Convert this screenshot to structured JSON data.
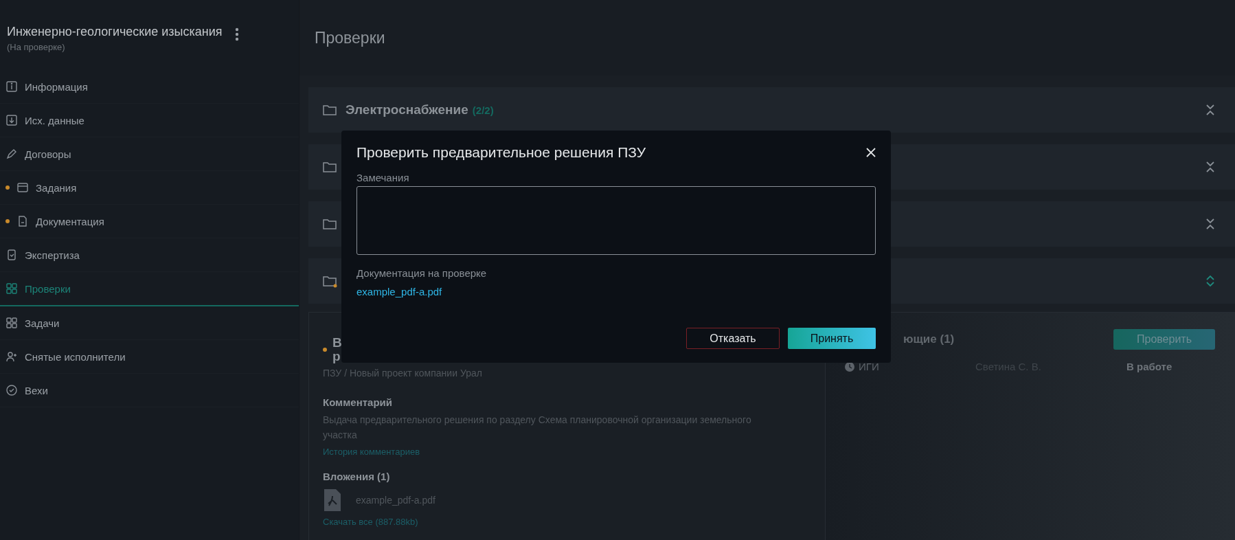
{
  "sidebar": {
    "title": "Инженерно-геологические изыскания",
    "subtitle": "(На проверке)",
    "items": [
      {
        "label": "Информация",
        "selected": false,
        "marked": false
      },
      {
        "label": "Исх. данные",
        "selected": false,
        "marked": false
      },
      {
        "label": "Договоры",
        "selected": false,
        "marked": false
      },
      {
        "label": "Задания",
        "selected": false,
        "marked": true
      },
      {
        "label": "Документация",
        "selected": false,
        "marked": true
      },
      {
        "label": "Экспертиза",
        "selected": false,
        "marked": false
      },
      {
        "label": "Проверки",
        "selected": true,
        "marked": false
      },
      {
        "label": "Задачи",
        "selected": false,
        "marked": false
      },
      {
        "label": "Снятые исполнители",
        "selected": false,
        "marked": false
      },
      {
        "label": "Вехи",
        "selected": false,
        "marked": false
      }
    ]
  },
  "page_title": "Проверки",
  "groups": [
    {
      "title": "Электроснабжение",
      "count": "(2/2)",
      "expanded": false,
      "marked": false
    },
    {
      "expanded": false,
      "marked": false
    },
    {
      "expanded": false,
      "marked": false
    },
    {
      "expanded": true,
      "marked": true
    }
  ],
  "card": {
    "title_lines": [
      "В",
      "р"
    ],
    "path": "ПЗУ / Новый проект компании Урал",
    "comment_label": "Комментарий",
    "comment": "Выдача предварительного решения по разделу Схема планировочной организации земельного участка",
    "history_link": "История комментариев",
    "attachments_label": "Вложения (1)",
    "attachments": [
      "example_pdf-a.pdf"
    ],
    "download_link": "Скачать все (887.88kb)"
  },
  "reviewers": {
    "heading": "ющие (1)",
    "button": "Проверить",
    "rows": [
      {
        "group": "ИГИ",
        "person": "Светина С. В.",
        "status": "В работе"
      }
    ]
  },
  "modal": {
    "title": "Проверить предварительное решения ПЗУ",
    "remarks_label": "Замечания",
    "docs_label": "Документация на проверке",
    "docs": [
      "example_pdf-a.pdf"
    ],
    "reject": "Отказать",
    "accept": "Принять"
  }
}
